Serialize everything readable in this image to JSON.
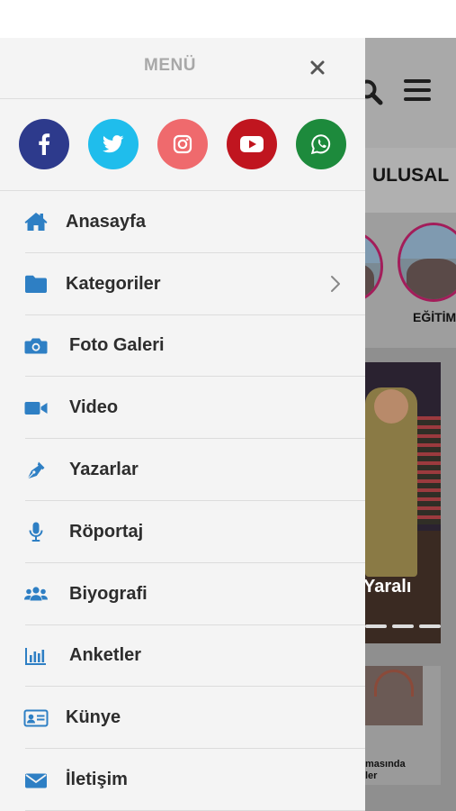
{
  "background": {
    "nav_label": "ULUSAL",
    "story_label": "EĞİTİM",
    "slider_text": "Yaralı",
    "card_text": "masında\nler",
    "search_icon": "search-icon",
    "menu_icon": "hamburger-icon"
  },
  "drawer": {
    "title": "MENÜ",
    "close_icon": "close-icon",
    "social": [
      {
        "name": "facebook-icon",
        "color": "#2d3a8c"
      },
      {
        "name": "twitter-icon",
        "color": "#1fbdec"
      },
      {
        "name": "instagram-icon",
        "color": "#ef6a6d"
      },
      {
        "name": "youtube-icon",
        "color": "#c0151f"
      },
      {
        "name": "whatsapp-icon",
        "color": "#1d8a3c"
      }
    ],
    "items": [
      {
        "label": "Anasayfa",
        "icon": "home-icon"
      },
      {
        "label": "Kategoriler",
        "icon": "folder-icon",
        "chevron": "chevron-right-icon"
      },
      {
        "label": "Foto Galeri",
        "icon": "camera-icon"
      },
      {
        "label": "Video",
        "icon": "video-camera-icon"
      },
      {
        "label": "Yazarlar",
        "icon": "pen-nib-icon"
      },
      {
        "label": "Röportaj",
        "icon": "microphone-icon"
      },
      {
        "label": "Biyografi",
        "icon": "users-icon"
      },
      {
        "label": "Anketler",
        "icon": "bar-chart-icon"
      },
      {
        "label": "Künye",
        "icon": "id-card-icon"
      },
      {
        "label": "İletişim",
        "icon": "envelope-icon"
      }
    ],
    "accent_color": "#2e7fc4"
  }
}
